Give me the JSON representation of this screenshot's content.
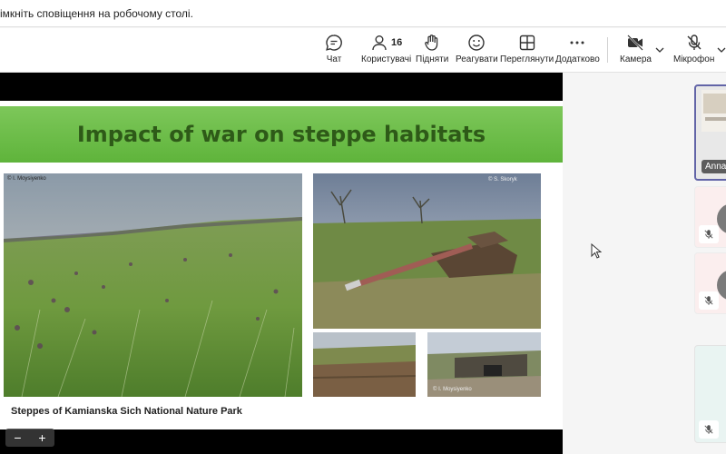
{
  "notification": "імкніть сповіщення на робочому столі.",
  "toolbar": {
    "chat": "Чат",
    "people": "Користувачі",
    "people_count": "16",
    "raise": "Підняти",
    "react": "Реагувати",
    "view": "Переглянути",
    "more": "Додатково",
    "camera": "Камера",
    "mic": "Мікрофон"
  },
  "slide": {
    "title": "Impact of war on steppe habitats",
    "credit_left": "© I. Moysiyenko",
    "credit_right": "© S. Skoryk",
    "credit_bottom": "© I. Moysiyenko",
    "caption": "Steppes of Kamianska Sich National Nature Park"
  },
  "zoom": {
    "minus": "−",
    "plus": "+"
  },
  "participants": [
    {
      "name": "Anna"
    }
  ]
}
